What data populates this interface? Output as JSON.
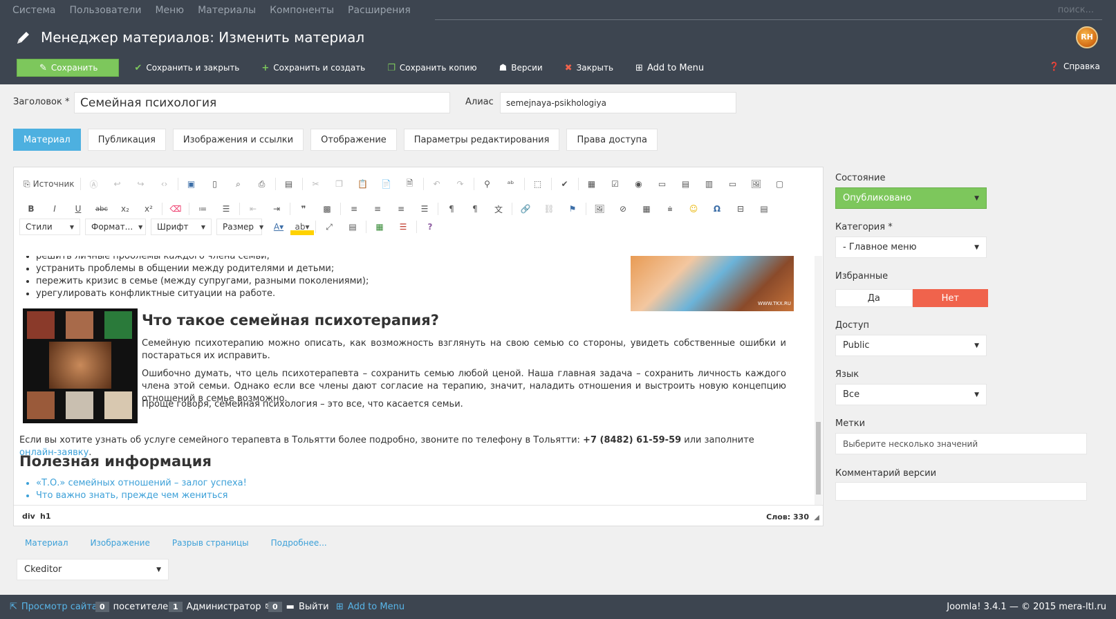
{
  "topnav": {
    "items": [
      "Система",
      "Пользователи",
      "Меню",
      "Материалы",
      "Компоненты",
      "Расширения"
    ],
    "search_placeholder": "поиск..."
  },
  "header": {
    "title": "Менеджер материалов: Изменить материал",
    "toolbar": {
      "save": "Сохранить",
      "save_close": "Сохранить и закрыть",
      "save_new": "Сохранить и создать",
      "save_copy": "Сохранить копию",
      "versions": "Версии",
      "close": "Закрыть",
      "add_to_menu": "Add to Menu",
      "help": "Справка"
    }
  },
  "form": {
    "title_label": "Заголовок *",
    "title_value": "Семейная психология",
    "alias_label": "Алиас",
    "alias_value": "semejnaya-psikhologiya"
  },
  "tabs": [
    "Материал",
    "Публикация",
    "Изображения и ссылки",
    "Отображение",
    "Параметры редактирования",
    "Права доступа"
  ],
  "editor": {
    "source_label": "Источник",
    "combos": [
      "Стили",
      "Формат...",
      "Шрифт",
      "Размер"
    ],
    "bullets_top": [
      "решить личные проблемы каждого члена семьи;",
      "устранить проблемы в общении между родителями и детьми;",
      "пережить кризис в семье (между супругами, разными поколениями);",
      "урегулировать конфликтные ситуации на работе."
    ],
    "heading1": "Что такое семейная психотерапия?",
    "para1": "Семейную психотерапию можно описать, как возможность взглянуть на свою семью со стороны, увидеть собственные ошибки и постараться их исправить.",
    "para2": "Ошибочно думать, что цель психотерапевта – сохранить семью любой ценой. Наша главная задача – сохранить личность каждого члена этой семьи. Однако если все члены дают согласие на терапию, значит, наладить отношения и выстроить новую концепцию отношений в семье возможно.",
    "para3": "Проще говоря, семейная психология – это все, что касается семьи.",
    "contact_prefix": "Если вы хотите узнать об услуге семейного терапевта в Тольятти более подробно, звоните по телефону в Тольятти: ",
    "contact_phone": "+7 (8482) 61-59-59",
    "contact_mid": " или заполните ",
    "contact_link": "онлайн-заявку",
    "contact_end": ".",
    "heading2": "Полезная информация",
    "links": [
      "«Т.О.» семейных отношений – залог успеха!",
      "Что важно знать, прежде чем жениться"
    ],
    "image_caption": "WWW.TKX.RU",
    "path": [
      "div",
      "h1"
    ],
    "word_count": "Слов: 330"
  },
  "editor_buttons": [
    "Материал",
    "Изображение",
    "Разрыв страницы",
    "Подробнее..."
  ],
  "editor_select": "Ckeditor",
  "sidebar": {
    "state_label": "Состояние",
    "state_value": "Опубликовано",
    "category_label": "Категория *",
    "category_value": "- Главное меню",
    "featured_label": "Избранные",
    "featured_yes": "Да",
    "featured_no": "Нет",
    "access_label": "Доступ",
    "access_value": "Public",
    "language_label": "Язык",
    "language_value": "Все",
    "tags_label": "Метки",
    "tags_placeholder": "Выберите несколько значений",
    "version_note_label": "Комментарий версии"
  },
  "footer": {
    "view_site": "Просмотр сайта",
    "visitors_count": "0",
    "visitors_label": "посетителей",
    "admin_count": "1",
    "admin_label": "Администратор",
    "messages_count": "0",
    "logout": "Выйти",
    "add_to_menu": "Add to Menu",
    "copyright": "Joomla! 3.4.1  —  © 2015 mera-ltl.ru"
  },
  "colors": {
    "dark_bg": "#3d4550",
    "green": "#7dc75c",
    "blue_tab": "#4db0e0",
    "red_no": "#f0634c",
    "link": "#3ca0d8"
  }
}
